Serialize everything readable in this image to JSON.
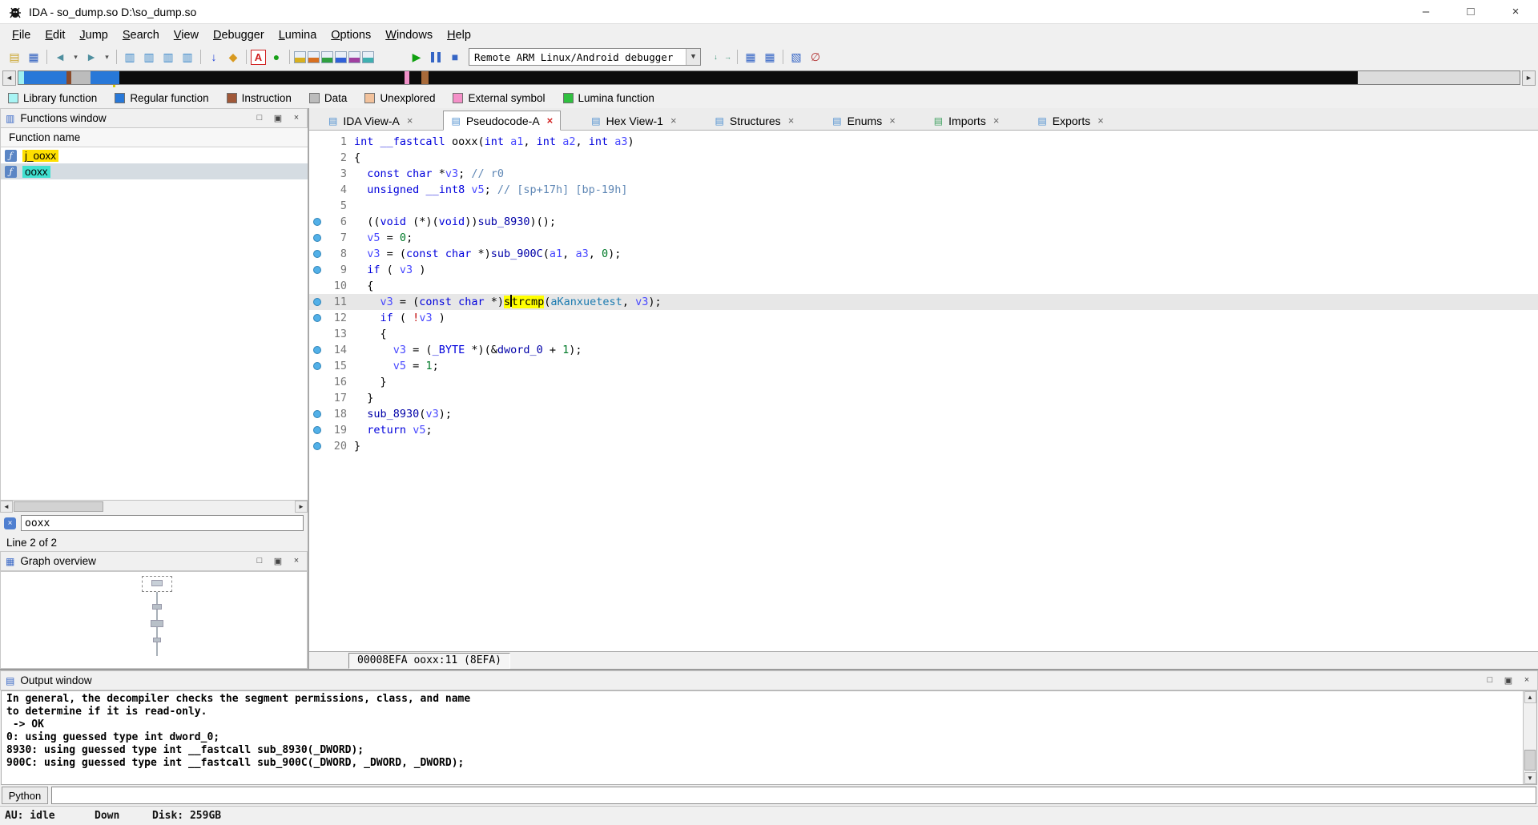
{
  "window": {
    "title": "IDA - so_dump.so D:\\so_dump.so"
  },
  "window_controls": {
    "minimize": "–",
    "maximize": "□",
    "close": "×"
  },
  "glyphs": {
    "maximize": "□",
    "float": "▣",
    "close": "×",
    "arrow_left": "◄",
    "arrow_right": "►",
    "arrow_up": "▲",
    "arrow_down": "▼",
    "clear_search": "×",
    "function_icon": "ƒ"
  },
  "menu": {
    "items": [
      "File",
      "Edit",
      "Jump",
      "Search",
      "View",
      "Debugger",
      "Lumina",
      "Options",
      "Windows",
      "Help"
    ]
  },
  "toolbar": {
    "debugger_combo": "Remote ARM Linux/Android debugger",
    "items": [
      {
        "t": "icon",
        "name": "new-file-icon",
        "g": "▤",
        "c": "#c9a227"
      },
      {
        "t": "icon",
        "name": "save-icon",
        "g": "▦",
        "c": "#2f5fbf"
      },
      {
        "t": "sep"
      },
      {
        "t": "icon",
        "name": "navigate-back-icon",
        "g": "◄",
        "c": "#4f8f9f"
      },
      {
        "t": "icon",
        "name": "back-history-icon",
        "g": "▾",
        "c": "#555555",
        "small": true
      },
      {
        "t": "icon",
        "name": "navigate-forward-icon",
        "g": "►",
        "c": "#4f8f9f"
      },
      {
        "t": "icon",
        "name": "forward-history-icon",
        "g": "▾",
        "c": "#555555",
        "small": true
      },
      {
        "t": "sep"
      },
      {
        "t": "icon",
        "name": "document-icon-1",
        "g": "▥",
        "c": "#3a86c8"
      },
      {
        "t": "icon",
        "name": "document-icon-2",
        "g": "▥",
        "c": "#3a86c8"
      },
      {
        "t": "icon",
        "name": "document-icon-3",
        "g": "▥",
        "c": "#3a86c8"
      },
      {
        "t": "icon",
        "name": "document-icon-4",
        "g": "▥",
        "c": "#3a86c8"
      },
      {
        "t": "sep"
      },
      {
        "t": "icon",
        "name": "jump-down-icon",
        "g": "↓",
        "c": "#2243d6"
      },
      {
        "t": "icon",
        "name": "bookmark-icon",
        "g": "◆",
        "c": "#d89a20"
      },
      {
        "t": "sep"
      },
      {
        "t": "icon",
        "name": "ascii-strings-icon",
        "g": "A",
        "c": "#d02020",
        "box": true
      },
      {
        "t": "icon",
        "name": "enabled-icon",
        "g": "●",
        "c": "#18a018"
      },
      {
        "t": "sep"
      },
      {
        "t": "stripes",
        "name": "segment-icon-1",
        "c": "#d8b020"
      },
      {
        "t": "stripes",
        "name": "segment-icon-2",
        "c": "#d87020"
      },
      {
        "t": "stripes",
        "name": "segment-icon-3",
        "c": "#30a040"
      },
      {
        "t": "stripes",
        "name": "segment-icon-4",
        "c": "#3060d8"
      },
      {
        "t": "stripes",
        "name": "segment-icon-5",
        "c": "#a040a0"
      },
      {
        "t": "stripes",
        "name": "segment-icon-6",
        "c": "#40b0b0"
      },
      {
        "t": "gap",
        "w": 40
      },
      {
        "t": "icon",
        "name": "run-icon",
        "g": "▶",
        "c": "#0fa00f"
      },
      {
        "t": "pause",
        "name": "pause-icon"
      },
      {
        "t": "icon",
        "name": "stop-icon",
        "g": "■",
        "c": "#3565c5"
      },
      {
        "t": "combo"
      },
      {
        "t": "gap",
        "w": 6
      },
      {
        "t": "icon",
        "name": "step-into-icon",
        "g": "↓",
        "c": "#2a8a6a",
        "small": true
      },
      {
        "t": "icon",
        "name": "step-over-icon",
        "g": "→",
        "c": "#2a8a6a",
        "small": true
      },
      {
        "t": "sep"
      },
      {
        "t": "icon",
        "name": "breakpoints-icon",
        "g": "▦",
        "c": "#3565c5"
      },
      {
        "t": "icon",
        "name": "watches-icon",
        "g": "▦",
        "c": "#3565c5"
      },
      {
        "t": "sep"
      },
      {
        "t": "icon",
        "name": "modules-icon",
        "g": "▧",
        "c": "#3565c5"
      },
      {
        "t": "icon",
        "name": "cancel-icon",
        "g": "∅",
        "c": "#b03030"
      }
    ]
  },
  "navband": {
    "segments": [
      {
        "color": "#9ff0f0",
        "w": 0.4
      },
      {
        "color": "#2878d8",
        "w": 2.8
      },
      {
        "color": "#8a4a2a",
        "w": 0.3
      },
      {
        "color": "#bcbcbc",
        "w": 1.3
      },
      {
        "color": "#2878d8",
        "w": 1.9
      },
      {
        "color": "#0b0b0b",
        "w": 19.0
      },
      {
        "color": "#f090c8",
        "w": 0.35
      },
      {
        "color": "#0b0b0b",
        "w": 0.8
      },
      {
        "color": "#a86a3a",
        "w": 0.45
      },
      {
        "color": "#0b0b0b",
        "w": 61.9
      },
      {
        "color": "#dcdcdc",
        "w": 10.8
      }
    ],
    "marker_pos": 6.3
  },
  "legend": {
    "items": [
      {
        "label": "Library function",
        "color": "#a8f4f4"
      },
      {
        "label": "Regular function",
        "color": "#2878d8"
      },
      {
        "label": "Instruction",
        "color": "#a05838"
      },
      {
        "label": "Data",
        "color": "#bcbcbc"
      },
      {
        "label": "Unexplored",
        "color": "#f2c29c"
      },
      {
        "label": "External symbol",
        "color": "#f490c8"
      },
      {
        "label": "Lumina function",
        "color": "#30c040"
      }
    ]
  },
  "functions_window": {
    "title": "Functions window",
    "title_icon": "▥",
    "column_header": "Function name",
    "items": [
      {
        "label": "j_ooxx",
        "highlight": "#ffe000",
        "selected": false
      },
      {
        "label": "ooxx",
        "highlight": "#40e0d0",
        "selected": true
      }
    ],
    "search_value": "ooxx",
    "line_status": "Line 2 of 2"
  },
  "graph_overview": {
    "title": "Graph overview",
    "title_icon": "▦"
  },
  "tabs": {
    "icon_glyph": "▤",
    "close_glyph": "×",
    "items": [
      {
        "label": "IDA View-A",
        "icon_color": "#4f8fd0",
        "active": false,
        "close_red": false
      },
      {
        "label": "Pseudocode-A",
        "icon_color": "#4f8fd0",
        "active": true,
        "close_red": true
      },
      {
        "label": "Hex View-1",
        "icon_color": "#4f8fd0",
        "active": false,
        "close_red": false
      },
      {
        "label": "Structures",
        "icon_color": "#4f8fd0",
        "active": false,
        "close_red": false
      },
      {
        "label": "Enums",
        "icon_color": "#4f8fd0",
        "active": false,
        "close_red": false
      },
      {
        "label": "Imports",
        "icon_color": "#3fa060",
        "active": false,
        "close_red": false
      },
      {
        "label": "Exports",
        "icon_color": "#4f8fd0",
        "active": false,
        "close_red": false
      }
    ]
  },
  "pseudocode": {
    "status": "00008EFA ooxx:11 (8EFA)",
    "lines": [
      {
        "n": 1,
        "bp": false,
        "segs": [
          [
            "kw",
            "int"
          ],
          [
            "pl",
            " "
          ],
          [
            "kw",
            "__fastcall"
          ],
          [
            "pl",
            " ooxx("
          ],
          [
            "kw",
            "int"
          ],
          [
            "pl",
            " "
          ],
          [
            "var",
            "a1"
          ],
          [
            "pl",
            ", "
          ],
          [
            "kw",
            "int"
          ],
          [
            "pl",
            " "
          ],
          [
            "var",
            "a2"
          ],
          [
            "pl",
            ", "
          ],
          [
            "kw",
            "int"
          ],
          [
            "pl",
            " "
          ],
          [
            "var",
            "a3"
          ],
          [
            "pl",
            ")"
          ]
        ]
      },
      {
        "n": 2,
        "bp": false,
        "segs": [
          [
            "pl",
            "{"
          ]
        ]
      },
      {
        "n": 3,
        "bp": false,
        "segs": [
          [
            "pl",
            "  "
          ],
          [
            "kw",
            "const"
          ],
          [
            "pl",
            " "
          ],
          [
            "kw",
            "char"
          ],
          [
            "pl",
            " *"
          ],
          [
            "var",
            "v3"
          ],
          [
            "pl",
            "; "
          ],
          [
            "cm",
            "// r0"
          ]
        ]
      },
      {
        "n": 4,
        "bp": false,
        "segs": [
          [
            "pl",
            "  "
          ],
          [
            "kw",
            "unsigned"
          ],
          [
            "pl",
            " "
          ],
          [
            "kw",
            "__int8"
          ],
          [
            "pl",
            " "
          ],
          [
            "var",
            "v5"
          ],
          [
            "pl",
            "; "
          ],
          [
            "cm",
            "// [sp+17h] [bp-19h]"
          ]
        ]
      },
      {
        "n": 5,
        "bp": false,
        "segs": []
      },
      {
        "n": 6,
        "bp": true,
        "segs": [
          [
            "pl",
            "  (("
          ],
          [
            "kw",
            "void"
          ],
          [
            "pl",
            " (*)("
          ],
          [
            "kw",
            "void"
          ],
          [
            "pl",
            "))"
          ],
          [
            "fn",
            "sub_8930"
          ],
          [
            "pl",
            ")();"
          ]
        ]
      },
      {
        "n": 7,
        "bp": true,
        "segs": [
          [
            "pl",
            "  "
          ],
          [
            "var",
            "v5"
          ],
          [
            "pl",
            " = "
          ],
          [
            "num",
            "0"
          ],
          [
            "pl",
            ";"
          ]
        ]
      },
      {
        "n": 8,
        "bp": true,
        "segs": [
          [
            "pl",
            "  "
          ],
          [
            "var",
            "v3"
          ],
          [
            "pl",
            " = ("
          ],
          [
            "kw",
            "const"
          ],
          [
            "pl",
            " "
          ],
          [
            "kw",
            "char"
          ],
          [
            "pl",
            " *)"
          ],
          [
            "fn",
            "sub_900C"
          ],
          [
            "pl",
            "("
          ],
          [
            "var",
            "a1"
          ],
          [
            "pl",
            ", "
          ],
          [
            "var",
            "a3"
          ],
          [
            "pl",
            ", "
          ],
          [
            "num",
            "0"
          ],
          [
            "pl",
            ");"
          ]
        ]
      },
      {
        "n": 9,
        "bp": true,
        "segs": [
          [
            "pl",
            "  "
          ],
          [
            "kw",
            "if"
          ],
          [
            "pl",
            " ( "
          ],
          [
            "var",
            "v3"
          ],
          [
            "pl",
            " )"
          ]
        ]
      },
      {
        "n": 10,
        "bp": false,
        "segs": [
          [
            "pl",
            "  {"
          ]
        ]
      },
      {
        "n": 11,
        "bp": true,
        "cur": true,
        "segs": [
          [
            "pl",
            "    "
          ],
          [
            "var",
            "v3"
          ],
          [
            "pl",
            " = ("
          ],
          [
            "kw",
            "const"
          ],
          [
            "pl",
            " "
          ],
          [
            "kw",
            "char"
          ],
          [
            "pl",
            " *)"
          ],
          [
            "hl",
            "s"
          ],
          [
            "caret",
            ""
          ],
          [
            "hl",
            "trcmp"
          ],
          [
            "pl",
            "("
          ],
          [
            "st",
            "aKanxuetest"
          ],
          [
            "pl",
            ", "
          ],
          [
            "var",
            "v3"
          ],
          [
            "pl",
            ");"
          ]
        ]
      },
      {
        "n": 12,
        "bp": true,
        "segs": [
          [
            "pl",
            "    "
          ],
          [
            "kw",
            "if"
          ],
          [
            "pl",
            " ( "
          ],
          [
            "ex",
            "!"
          ],
          [
            "var",
            "v3"
          ],
          [
            "pl",
            " )"
          ]
        ]
      },
      {
        "n": 13,
        "bp": false,
        "segs": [
          [
            "pl",
            "    {"
          ]
        ]
      },
      {
        "n": 14,
        "bp": true,
        "segs": [
          [
            "pl",
            "      "
          ],
          [
            "var",
            "v3"
          ],
          [
            "pl",
            " = ("
          ],
          [
            "kw",
            "_BYTE"
          ],
          [
            "pl",
            " *)(&"
          ],
          [
            "fn",
            "dword_0"
          ],
          [
            "pl",
            " + "
          ],
          [
            "num",
            "1"
          ],
          [
            "pl",
            ");"
          ]
        ]
      },
      {
        "n": 15,
        "bp": true,
        "segs": [
          [
            "pl",
            "      "
          ],
          [
            "var",
            "v5"
          ],
          [
            "pl",
            " = "
          ],
          [
            "num",
            "1"
          ],
          [
            "pl",
            ";"
          ]
        ]
      },
      {
        "n": 16,
        "bp": false,
        "segs": [
          [
            "pl",
            "    }"
          ]
        ]
      },
      {
        "n": 17,
        "bp": false,
        "segs": [
          [
            "pl",
            "  }"
          ]
        ]
      },
      {
        "n": 18,
        "bp": true,
        "segs": [
          [
            "pl",
            "  "
          ],
          [
            "fn",
            "sub_8930"
          ],
          [
            "pl",
            "("
          ],
          [
            "var",
            "v3"
          ],
          [
            "pl",
            ");"
          ]
        ]
      },
      {
        "n": 19,
        "bp": true,
        "segs": [
          [
            "pl",
            "  "
          ],
          [
            "kw",
            "return"
          ],
          [
            "pl",
            " "
          ],
          [
            "var",
            "v5"
          ],
          [
            "pl",
            ";"
          ]
        ]
      },
      {
        "n": 20,
        "bp": true,
        "segs": [
          [
            "pl",
            "}"
          ]
        ]
      }
    ]
  },
  "output_window": {
    "title": "Output window",
    "title_icon": "▤",
    "lines": [
      "In general, the decompiler checks the segment permissions, class, and name",
      "to determine if it is read-only.",
      " -> OK",
      "0: using guessed type int dword_0;",
      "8930: using guessed type int __fastcall sub_8930(_DWORD);",
      "900C: using guessed type int __fastcall sub_900C(_DWORD, _DWORD, _DWORD);"
    ],
    "python_label": "Python",
    "python_value": ""
  },
  "statusbar": {
    "au": "AU: idle",
    "mode": "Down",
    "disk": "Disk: 259GB"
  }
}
